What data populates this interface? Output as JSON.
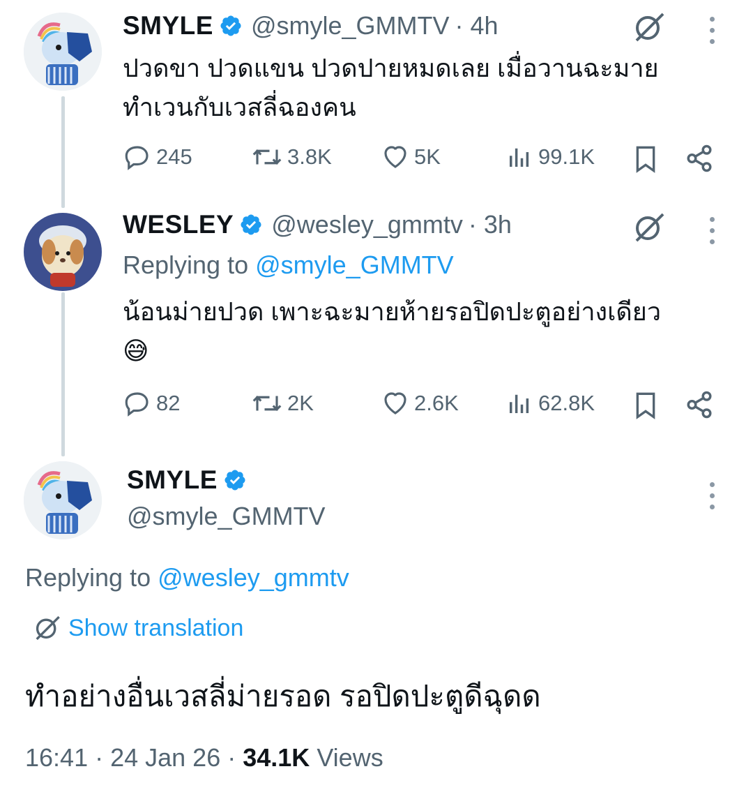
{
  "tweets": [
    {
      "name": "SMYLE",
      "handle": "@smyle_GMMTV",
      "time": "· 4h",
      "text_line1": "ปวดขา ปวดแขน ปวดปายหมดเลย เมื่อวานฉะมาย",
      "text_line2": "ทำเวนกับเวสลี่ฉองคน",
      "replies": "245",
      "reposts": "3.8K",
      "likes": "5K",
      "views": "99.1K"
    },
    {
      "name": "WESLEY",
      "handle": "@wesley_gmmtv",
      "time": "· 3h",
      "replying_prefix": "Replying to",
      "replying_handle": "@smyle_GMMTV",
      "text_line1": "น้อนม่ายปวด เพาะฉะมายห้ายรอปิดปะตูอย่างเดียว",
      "emoji": "😅",
      "replies": "82",
      "reposts": "2K",
      "likes": "2.6K",
      "views": "62.8K"
    }
  ],
  "main": {
    "name": "SMYLE",
    "handle": "@smyle_GMMTV",
    "replying_prefix": "Replying to",
    "replying_handle": "@wesley_gmmtv",
    "show_translation": "Show translation",
    "text": "ทำอย่างอื่นเวสลี่ม่ายรอด รอปิดปะตูดีฉุดด",
    "timestamp": "16:41 · 24 Jan 26 ·",
    "views_count": "34.1K",
    "views_label": "Views"
  },
  "colors": {
    "accent": "#1d9bf0",
    "muted": "#536471",
    "thread_line": "#cfd9de"
  }
}
